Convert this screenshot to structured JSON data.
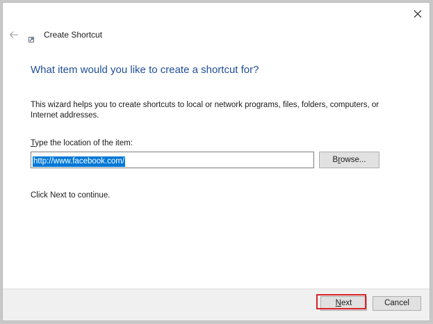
{
  "window": {
    "title": "Create Shortcut"
  },
  "main": {
    "heading": "What item would you like to create a shortcut for?",
    "description": "This wizard helps you to create shortcuts to local or network programs, files, folders, computers, or Internet addresses.",
    "location_label_hotkey": "T",
    "location_label_rest": "ype the location of the item:",
    "location_value": "http://www.facebook.com/",
    "browse_hotkey": "r",
    "browse_before": "B",
    "browse_after": "owse...",
    "continue_text": "Click Next to continue."
  },
  "footer": {
    "next_hotkey": "N",
    "next_rest": "ext",
    "cancel_label": "Cancel"
  },
  "colors": {
    "heading": "#1f4e96",
    "selection": "#0078d7",
    "highlight": "#d8232a"
  }
}
